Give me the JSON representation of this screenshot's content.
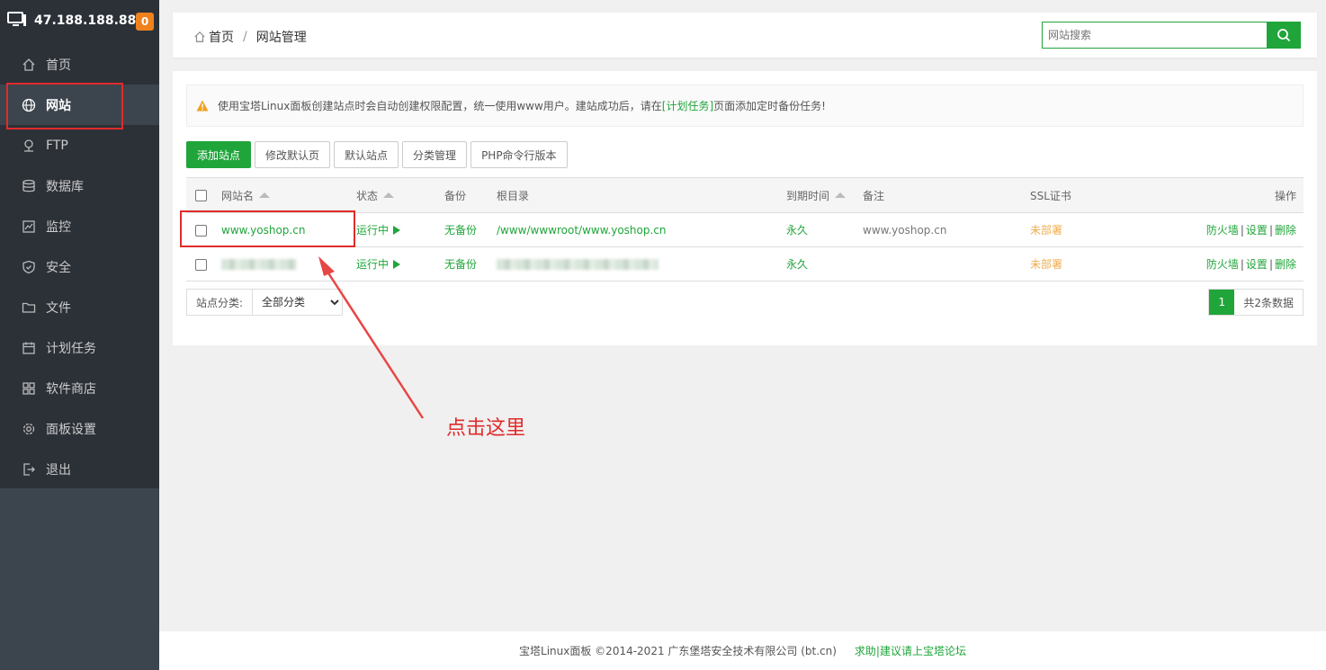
{
  "sidebar": {
    "server_ip": "47.188.188.88",
    "notification_count": "0",
    "items": [
      {
        "label": "首页",
        "icon": "home-icon"
      },
      {
        "label": "网站",
        "icon": "globe-icon",
        "active": true
      },
      {
        "label": "FTP",
        "icon": "ftp-icon"
      },
      {
        "label": "数据库",
        "icon": "database-icon"
      },
      {
        "label": "监控",
        "icon": "monitor-icon"
      },
      {
        "label": "安全",
        "icon": "shield-icon"
      },
      {
        "label": "文件",
        "icon": "folder-icon"
      },
      {
        "label": "计划任务",
        "icon": "task-icon"
      },
      {
        "label": "软件商店",
        "icon": "apps-icon"
      },
      {
        "label": "面板设置",
        "icon": "gear-icon"
      },
      {
        "label": "退出",
        "icon": "logout-icon"
      }
    ]
  },
  "header": {
    "breadcrumb_home": "首页",
    "breadcrumb_sep": "/",
    "breadcrumb_current": "网站管理",
    "search_placeholder": "网站搜索"
  },
  "notice": {
    "text_before": "使用宝塔Linux面板创建站点时会自动创建权限配置，统一使用www用户。建站成功后，请在",
    "link": "[计划任务]",
    "text_after": "页面添加定时备份任务!"
  },
  "toolbar": {
    "add_site": "添加站点",
    "edit_default_page": "修改默认页",
    "default_site": "默认站点",
    "category_manage": "分类管理",
    "php_cli_version": "PHP命令行版本"
  },
  "table": {
    "headers": {
      "name": "网站名",
      "status": "状态",
      "backup": "备份",
      "root": "根目录",
      "expire": "到期时间",
      "remark": "备注",
      "ssl": "SSL证书",
      "actions": "操作"
    },
    "rows": [
      {
        "name": "www.yoshop.cn",
        "status": "运行中",
        "backup": "无备份",
        "root": "/www/wwwroot/www.yoshop.cn",
        "expire": "永久",
        "remark": "www.yoshop.cn",
        "ssl": "未部署",
        "firewall": "防火墙",
        "settings": "设置",
        "delete": "删除",
        "action_sep": "|"
      },
      {
        "name": "",
        "status": "运行中",
        "backup": "无备份",
        "root": "",
        "expire": "永久",
        "remark": "",
        "ssl": "未部署",
        "firewall": "防火墙",
        "settings": "设置",
        "delete": "删除",
        "action_sep": "|"
      }
    ]
  },
  "filter": {
    "category_label": "站点分类:",
    "category_selected": "全部分类"
  },
  "pagination": {
    "current_page": "1",
    "total": "共2条数据"
  },
  "annotation": {
    "text": "点击这里"
  },
  "footer": {
    "copyright": "宝塔Linux面板 ©2014-2021 广东堡塔安全技术有限公司 (bt.cn)",
    "forum_link": "求助|建议请上宝塔论坛"
  },
  "colors": {
    "accent": "#20a53a",
    "sidebar_bg": "#3c444d",
    "highlight_red": "#e02b2b",
    "ssl_orange": "#f0ad4e"
  }
}
